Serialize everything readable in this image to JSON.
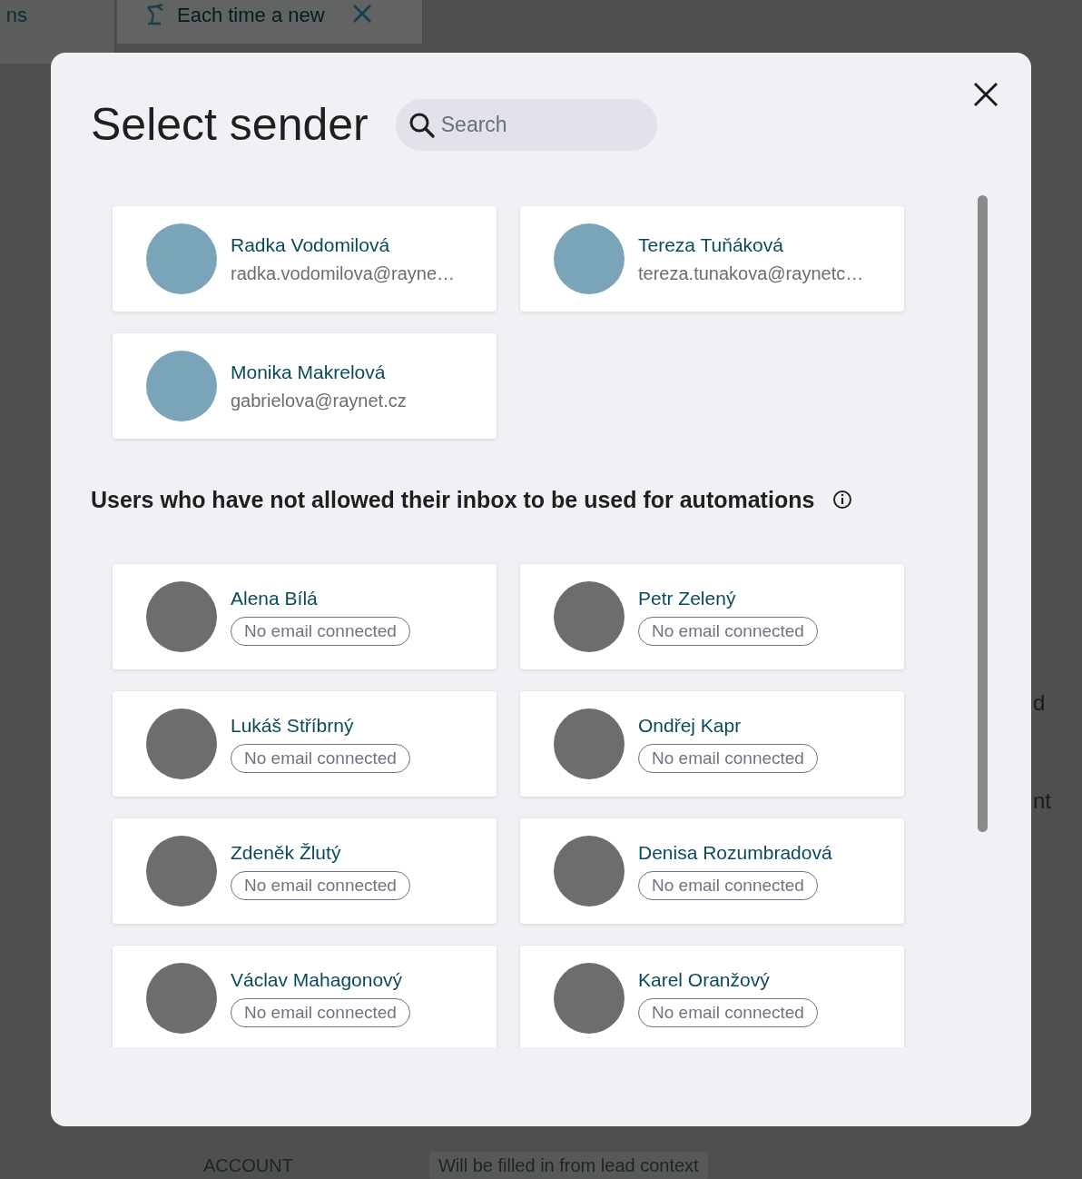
{
  "background": {
    "tabs": [
      {
        "label": "ns",
        "selected": false,
        "closable": false
      },
      {
        "label": "Each time a new",
        "selected": true,
        "closable": true
      }
    ],
    "side_fragments": [
      "d",
      "nt"
    ],
    "field": {
      "label": "ACCOUNT",
      "value": "Will be filled in from lead context"
    }
  },
  "dialog": {
    "title": "Select sender",
    "search": {
      "placeholder": "Search"
    },
    "senders": [
      {
        "name": "Radka Vodomilová",
        "email": "radka.vodomilova@rayne…"
      },
      {
        "name": "Tereza Tuňáková",
        "email": "tereza.tunakova@raynetc…"
      },
      {
        "name": "Monika Makrelová",
        "email": "gabrielova@raynet.cz"
      }
    ],
    "no_inbox_section": {
      "title": "Users who have not allowed their inbox to be used for automations",
      "users": [
        {
          "name": "Alena Bílá",
          "status": "No email connected"
        },
        {
          "name": "Petr Zelený",
          "status": "No email connected"
        },
        {
          "name": "Lukáš Stříbrný",
          "status": "No email connected"
        },
        {
          "name": "Ondřej Kapr",
          "status": "No email connected"
        },
        {
          "name": "Zdeněk Žlutý",
          "status": "No email connected"
        },
        {
          "name": "Denisa Rozumbradová",
          "status": "No email connected"
        },
        {
          "name": "Václav Mahagonový",
          "status": "No email connected"
        },
        {
          "name": "Karel Oranžový",
          "status": "No email connected"
        }
      ]
    }
  }
}
